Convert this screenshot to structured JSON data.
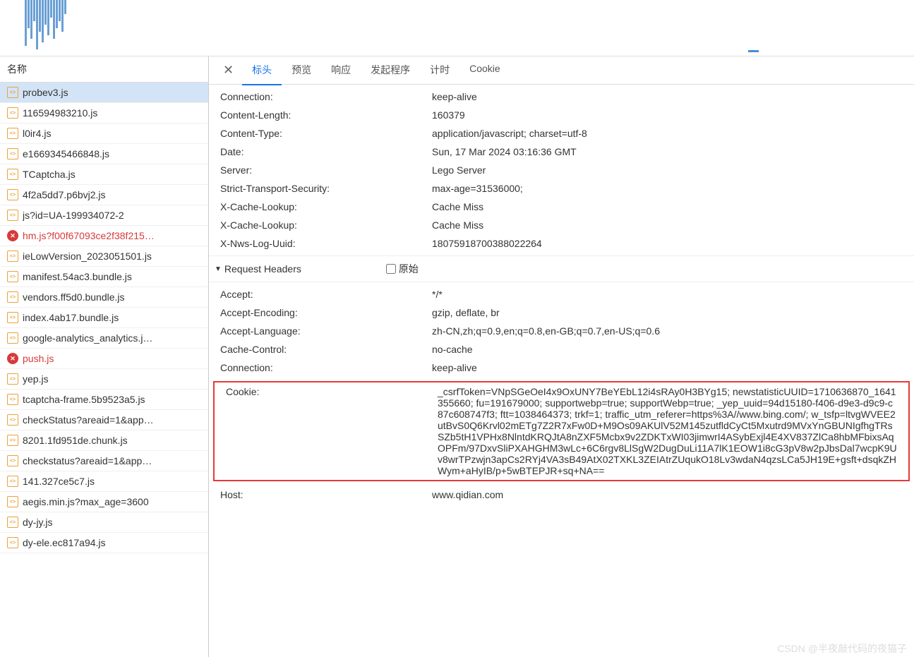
{
  "sidebar": {
    "title": "名称",
    "items": [
      {
        "name": "probev3.js",
        "type": "js",
        "selected": true
      },
      {
        "name": "116594983210.js",
        "type": "js"
      },
      {
        "name": "l0ir4.js",
        "type": "js"
      },
      {
        "name": "e1669345466848.js",
        "type": "js"
      },
      {
        "name": "TCaptcha.js",
        "type": "js"
      },
      {
        "name": "4f2a5dd7.p6bvj2.js",
        "type": "js"
      },
      {
        "name": "js?id=UA-199934072-2",
        "type": "js"
      },
      {
        "name": "hm.js?f00f67093ce2f38f215…",
        "type": "error"
      },
      {
        "name": "ieLowVersion_2023051501.js",
        "type": "js"
      },
      {
        "name": "manifest.54ac3.bundle.js",
        "type": "js"
      },
      {
        "name": "vendors.ff5d0.bundle.js",
        "type": "js"
      },
      {
        "name": "index.4ab17.bundle.js",
        "type": "js"
      },
      {
        "name": "google-analytics_analytics.j…",
        "type": "js"
      },
      {
        "name": "push.js",
        "type": "error"
      },
      {
        "name": "yep.js",
        "type": "js"
      },
      {
        "name": "tcaptcha-frame.5b9523a5.js",
        "type": "js"
      },
      {
        "name": "checkStatus?areaid=1&app…",
        "type": "js"
      },
      {
        "name": "8201.1fd951de.chunk.js",
        "type": "js"
      },
      {
        "name": "checkstatus?areaid=1&app…",
        "type": "js"
      },
      {
        "name": "141.327ce5c7.js",
        "type": "js"
      },
      {
        "name": "aegis.min.js?max_age=3600",
        "type": "js"
      },
      {
        "name": "dy-jy.js",
        "type": "js"
      },
      {
        "name": "dy-ele.ec817a94.js",
        "type": "js"
      }
    ]
  },
  "tabs": {
    "items": [
      "标头",
      "预览",
      "响应",
      "发起程序",
      "计时",
      "Cookie"
    ],
    "active": 0
  },
  "response_headers": [
    {
      "key": "Connection:",
      "val": "keep-alive"
    },
    {
      "key": "Content-Length:",
      "val": "160379"
    },
    {
      "key": "Content-Type:",
      "val": "application/javascript; charset=utf-8"
    },
    {
      "key": "Date:",
      "val": "Sun, 17 Mar 2024 03:16:36 GMT"
    },
    {
      "key": "Server:",
      "val": "Lego Server"
    },
    {
      "key": "Strict-Transport-Security:",
      "val": "max-age=31536000;"
    },
    {
      "key": "X-Cache-Lookup:",
      "val": "Cache Miss"
    },
    {
      "key": "X-Cache-Lookup:",
      "val": "Cache Miss"
    },
    {
      "key": "X-Nws-Log-Uuid:",
      "val": "18075918700388022264"
    }
  ],
  "request_section": {
    "title": "Request Headers",
    "raw_label": "原始"
  },
  "request_headers_pre": [
    {
      "key": "Accept:",
      "val": "*/*"
    },
    {
      "key": "Accept-Encoding:",
      "val": "gzip, deflate, br"
    },
    {
      "key": "Accept-Language:",
      "val": "zh-CN,zh;q=0.9,en;q=0.8,en-GB;q=0.7,en-US;q=0.6"
    },
    {
      "key": "Cache-Control:",
      "val": "no-cache"
    },
    {
      "key": "Connection:",
      "val": "keep-alive"
    }
  ],
  "cookie_row": {
    "key": "Cookie:",
    "val": "_csrfToken=VNpSGeOeI4x9OxUNY7BeYEbL12i4sRAy0H3BYg15; newstatisticUUID=1710636870_1641355660; fu=191679000; supportwebp=true; supportWebp=true; _yep_uuid=94d15180-f406-d9e3-d9c9-c87c608747f3; ftt=1038464373; trkf=1; traffic_utm_referer=https%3A//www.bing.com/; w_tsfp=ltvgWVEE2utBvS0Q6Krvl02mETg7Z2R7xFw0D+M9Os09AKUlV52M145zutfldCyCt5Mxutrd9MVxYnGBUNIgfhgTRsSZb5tH1VPHx8NlntdKRQJtA8nZXF5Mcbx9v2ZDKTxWI03jimwrI4ASybExjl4E4XV837ZlCa8hbMFbixsAqOPFm/97DxvSliPXAHGHM3wLc+6C6rgv8LlSgW2DugDuLi11A7lK1EOW1i8cG3pV8w2pJbsDal7wcpK9Uv8wrTPzwjn3apCs2RYj4VA3sB49AtX02TXKL3ZEIAtrZUqukO18Lv3wdaN4qzsLCa5JH19E+gsft+dsqkZHWym+aHyIB/p+5wBTEPJR+sq+NA=="
  },
  "request_headers_post": [
    {
      "key": "Host:",
      "val": "www.qidian.com"
    }
  ],
  "watermark": "CSDN @半夜敲代码的夜猫子"
}
